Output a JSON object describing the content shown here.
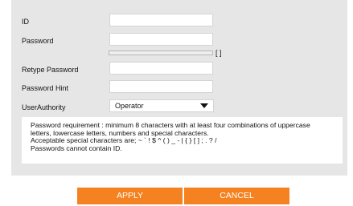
{
  "form": {
    "id_label": "ID",
    "id_value": "",
    "password_label": "Password",
    "password_value": "",
    "strength_indicator": "[ ]",
    "strength_level_percent": 0,
    "retype_label": "Retype Password",
    "retype_value": "",
    "hint_label": "Password Hint",
    "hint_value": "",
    "authority_label": "UserAuthority",
    "authority_selected": "Operator"
  },
  "requirements": {
    "line1": "Password requirement : minimum 8 characters with at least four combinations of uppercase",
    "line2": "letters, lowercase letters, numbers and special characters.",
    "line3": "Acceptable special characters are; ~ ` ! $ ^ ( ) _ - | { } [ ] ; . ? /",
    "line4": "Passwords cannot contain ID."
  },
  "buttons": {
    "apply_label": "APPLY",
    "cancel_label": "CANCEL"
  },
  "colors": {
    "panel_background": "#e6e6e6",
    "button_accent": "#f58220"
  }
}
